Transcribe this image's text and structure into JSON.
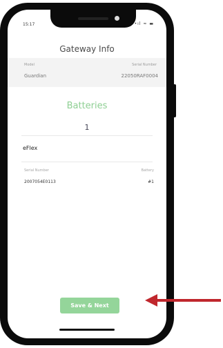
{
  "status": {
    "time": "15:17",
    "icons": "•ıl ≈ ▬"
  },
  "header": {
    "title": "Gateway Info"
  },
  "info": {
    "model_label": "Model",
    "model_value": "Guardian",
    "serial_label": "Serial Number",
    "serial_value": "22050RAF0004"
  },
  "batteries": {
    "title": "Batteries",
    "count": "1",
    "type": "eFlex",
    "headers": {
      "serial": "Serial Number",
      "battery": "Battery"
    },
    "rows": [
      {
        "serial": "2007054E0113",
        "battery": "#1"
      }
    ]
  },
  "footer": {
    "save_label": "Save & Next"
  },
  "colors": {
    "accent": "#94d59a",
    "title_green": "#8ecf93",
    "arrow": "#c0272d"
  }
}
